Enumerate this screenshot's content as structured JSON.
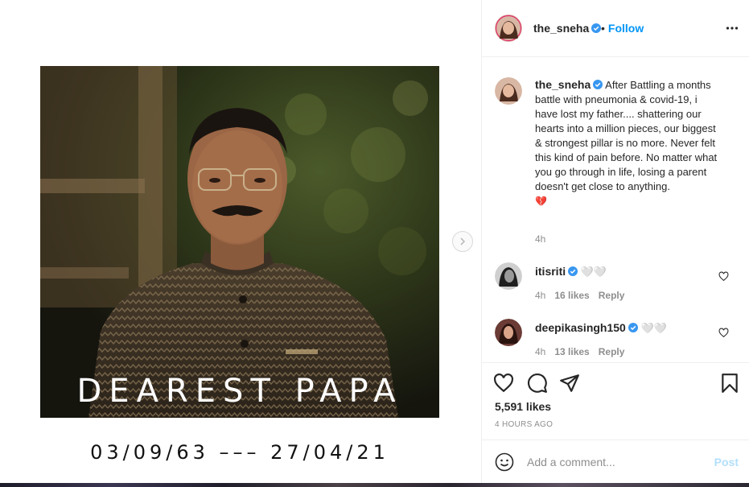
{
  "post": {
    "username": "the_sneha",
    "follow_label": "Follow",
    "dot": "•"
  },
  "media": {
    "overlay_text": "DEAREST PAPA",
    "dates": "03/09/63 ––– 27/04/21"
  },
  "caption": {
    "username": "the_sneha",
    "text": "After Battling a months battle with pneumonia & covid-19, i have lost my father.... shattering our hearts into a million pieces, our biggest & strongest pillar is no more. Never felt this kind of pain before. No matter what you go through in life, losing a parent doesn't get close to anything.",
    "emoji": "💔",
    "time": "4h"
  },
  "comments": [
    {
      "username": "itisriti",
      "text": "🤍🤍",
      "time": "4h",
      "likes": "16 likes",
      "reply": "Reply"
    },
    {
      "username": "deepikasingh150",
      "text": "🤍🤍",
      "time": "4h",
      "likes": "13 likes",
      "reply": "Reply"
    }
  ],
  "stats": {
    "likes": "5,591 likes",
    "time_ago": "4 HOURS AGO"
  },
  "add_comment": {
    "placeholder": "Add a comment...",
    "post_label": "Post"
  },
  "colors": {
    "accent": "#0095f6",
    "post_disabled": "#b2dffc",
    "secondary_text": "#8e8e8e",
    "verified": "#3897f0"
  }
}
